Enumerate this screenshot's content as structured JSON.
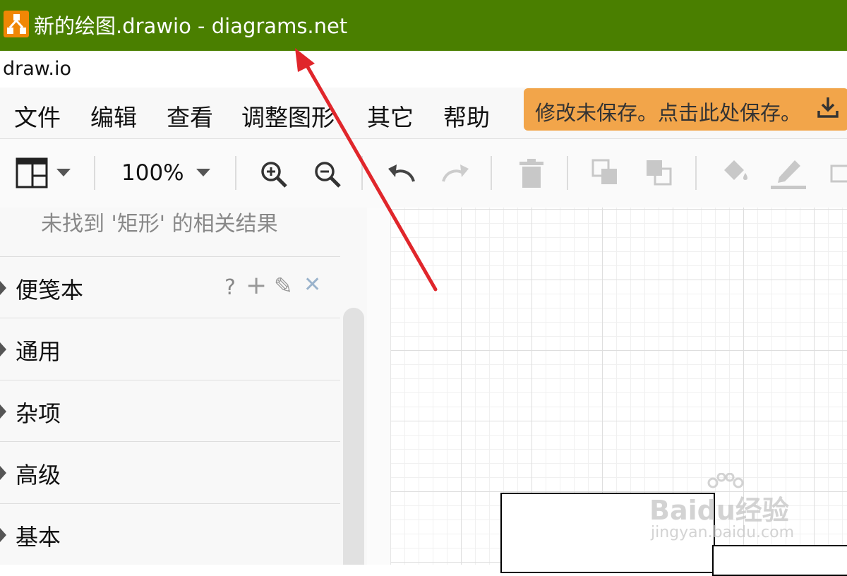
{
  "window": {
    "title": "新的绘图.drawio - diagrams.net",
    "url": "draw.io"
  },
  "menu": {
    "items": [
      "文件",
      "编辑",
      "查看",
      "调整图形",
      "其它",
      "帮助"
    ]
  },
  "save_banner": {
    "text": "修改未保存。点击此处保存。",
    "icon": "download-icon"
  },
  "toolbar": {
    "zoom": "100%",
    "icons": [
      "format-panel-icon",
      "zoom-in-icon",
      "zoom-out-icon",
      "undo-icon",
      "redo-icon",
      "delete-icon",
      "to-front-icon",
      "to-back-icon",
      "fill-color-icon",
      "line-color-icon",
      "shadow-icon"
    ]
  },
  "sidebar": {
    "no_result": "未找到 '矩形' 的相关结果",
    "scratchpad_actions": [
      "?",
      "+",
      "✎",
      "✕"
    ],
    "sections": [
      "便笺本",
      "通用",
      "杂项",
      "高级",
      "基本"
    ]
  },
  "watermark": {
    "brand": "Baidu经验",
    "sub": "jingyan.baidu.com"
  },
  "colors": {
    "titlebar": "#4a7f00",
    "save_banner": "#f2a54a",
    "app_icon": "#f08705",
    "arrow": "#e0262b"
  }
}
